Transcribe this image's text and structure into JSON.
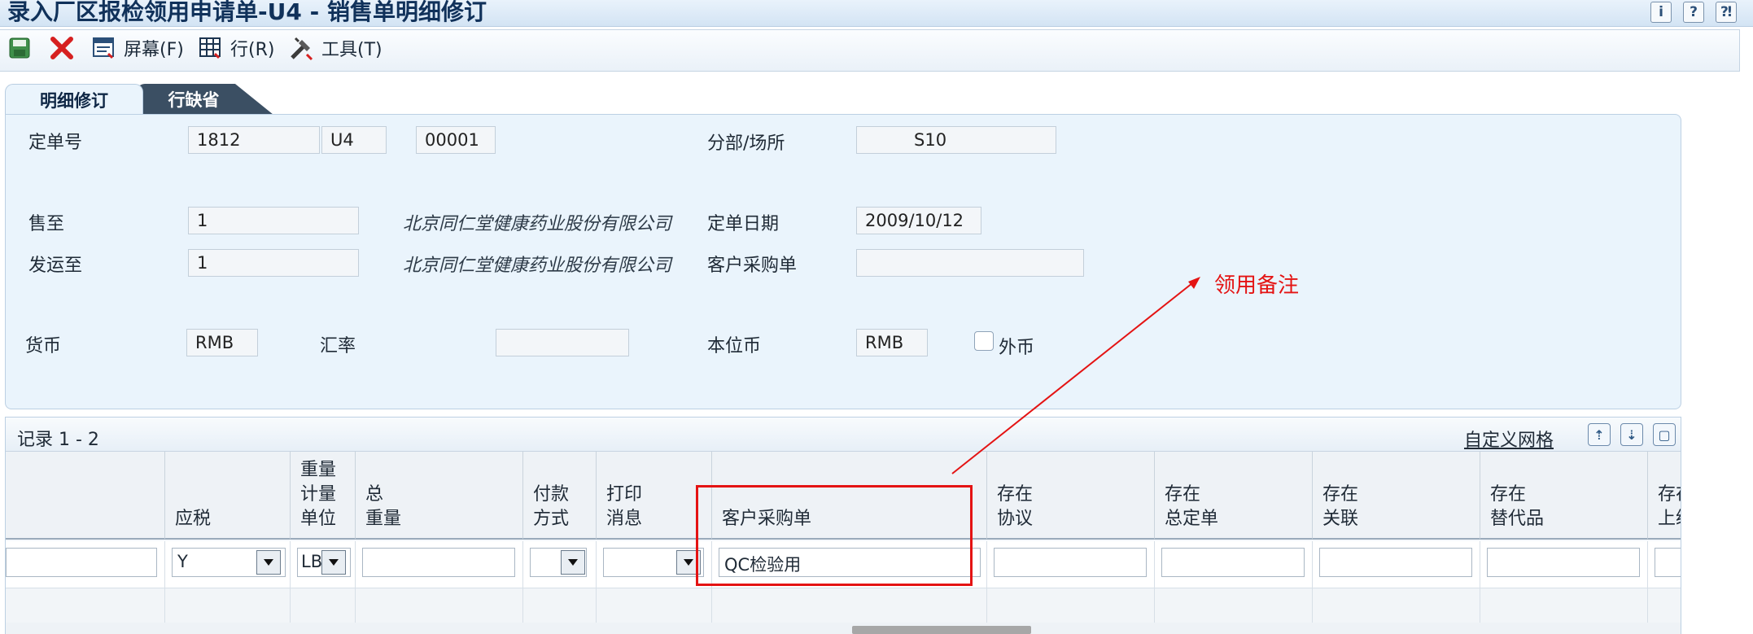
{
  "window": {
    "title": "录入厂区报检领用申请单-U4 - 销售单明细修订",
    "icons": [
      "info-icon",
      "help-icon",
      "context-help-icon"
    ]
  },
  "toolbar": {
    "screen_label": "屏幕(F)",
    "row_label": "行(R)",
    "tools_label": "工具(T)"
  },
  "tabs": {
    "active": "明细修订",
    "inactive": "行缺省"
  },
  "header": {
    "order_no_label": "定单号",
    "order_no": "1812",
    "order_type": "U4",
    "order_company": "00001",
    "branch_label": "分部/场所",
    "branch": "S10",
    "sold_to_label": "售至",
    "sold_to": "1",
    "sold_to_name": "北京同仁堂健康药业股份有限公司",
    "order_date_label": "定单日期",
    "order_date": "2009/10/12",
    "ship_to_label": "发运至",
    "ship_to": "1",
    "ship_to_name": "北京同仁堂健康药业股份有限公司",
    "customer_po_label": "客户采购单",
    "customer_po": "",
    "currency_label": "货币",
    "currency": "RMB",
    "exchange_rate_label": "汇率",
    "exchange_rate": "",
    "base_currency_label": "本位币",
    "base_currency": "RMB",
    "foreign_label": "外币",
    "foreign_checked": false
  },
  "grid": {
    "records_label": "记录 1 - 2",
    "customize_label": "自定义网格",
    "columns": [
      "",
      "应税",
      "重量\n计量\n单位",
      "总\n重量",
      "付款\n方式",
      "打印\n消息",
      "客户采购单",
      "存在\n协议",
      "存在\n总定单",
      "存在\n关联",
      "存在\n替代品",
      "存在\n上级"
    ],
    "row1": {
      "taxable": "Y",
      "weight_uom": "LB",
      "customer_po": "QC检验用"
    }
  },
  "annotation": {
    "text": "领用备注",
    "color": "#e41313"
  }
}
